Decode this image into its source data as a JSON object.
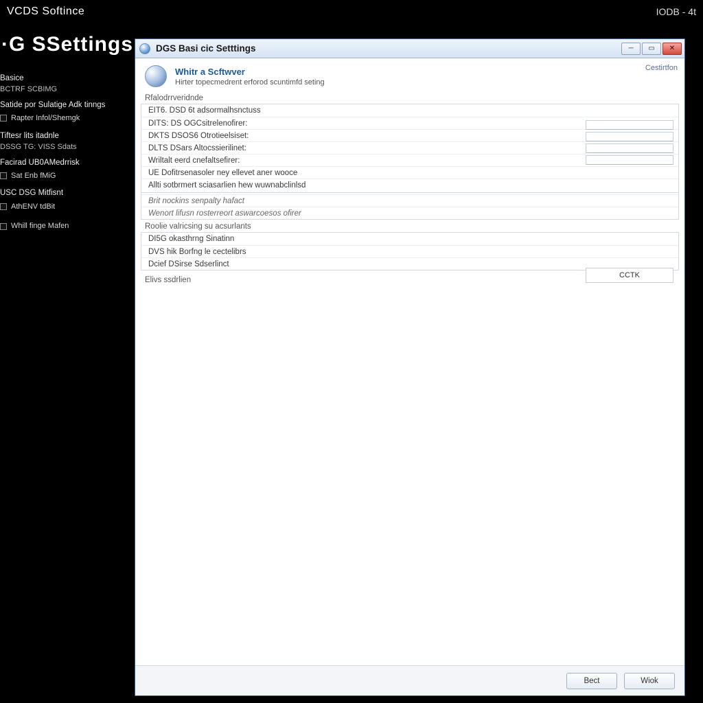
{
  "topbar": {
    "app": "VCDS Softince",
    "code": "IODB - 4t"
  },
  "bigtitle": {
    "text": "·G SSettings",
    "chev": "›"
  },
  "sidebar": {
    "groups": [
      {
        "header": "Basice",
        "sub": "BCTRF SCBIMG",
        "items": []
      },
      {
        "header": "Satide por Sulatige Adk tinngs",
        "sub": "",
        "items": [
          {
            "cb": true,
            "label": "Rapter Infol/Shemgk"
          }
        ]
      },
      {
        "header": "Tiftesr lits itadnle",
        "sub": "DSSG TG: VISS Sdats",
        "items": []
      },
      {
        "header": "Facirad UB0AMedrrisk",
        "sub": "",
        "items": [
          {
            "cb": true,
            "label": "Sat Enb fMiG"
          }
        ]
      },
      {
        "header": "USC DSG Mitfisnt",
        "sub": "",
        "items": [
          {
            "cb": true,
            "label": "AthENV tdBit"
          }
        ]
      },
      {
        "header": "",
        "sub": "",
        "items": [
          {
            "cb": true,
            "label": "Whill finge Mafen"
          }
        ]
      }
    ]
  },
  "dialog": {
    "title": "DGS Basi cic Setttings",
    "corner_link": "Cestirtfon",
    "header": {
      "t1": "Whitr a Scftwver",
      "t2": "Hirter topecmedrent erforod scuntimfd seting"
    },
    "section1": {
      "label": "Rfalodrrveridnde",
      "rows": [
        "EIT6. DSD 6t adsormalhsnctuss",
        "DITS: DS OGCsitrelenofirer:",
        "DKTS DSOS6 Otrotieelsiset:",
        "DLTS DSars Altocssierilinet:",
        "Wriltalt eerd cnefaltsefirer:",
        "UE Dofitrsenasoler ney ellevet aner wooce",
        "Allti sotbrmert sciasarlien hew wuwnabclinlsd"
      ]
    },
    "subrows": [
      "Brit nockins senpalty hafact",
      "Wenort lifusn rosterreort aswarcoesos ofirer"
    ],
    "section2": {
      "label": "Roolie valricsing su acsurlants",
      "rows": [
        "DI5G okasthrng Sinatinn",
        "DVS hik Borfng le cectelibrs",
        "Dcief DSirse Sdserlinct"
      ]
    },
    "tail": "Elivs ssdrlien",
    "ok_label": "CCTK",
    "buttons": {
      "back": "Bect",
      "next": "Wiok"
    }
  }
}
